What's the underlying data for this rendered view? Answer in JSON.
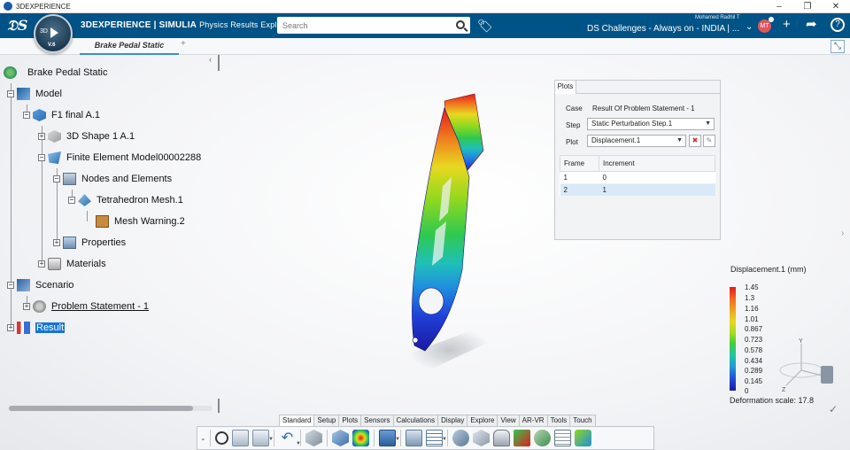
{
  "window": {
    "title": "3DEXPERIENCE",
    "buttons": [
      "–",
      "❐",
      "✕"
    ]
  },
  "topbar": {
    "brand_bold": "3DEXPERIENCE | SIMULIA",
    "app_name": "Physics Results Explorer",
    "compass": {
      "label_3d": "3D",
      "version": "V.6"
    },
    "search": {
      "value": "",
      "placeholder": "Search"
    },
    "user_name": "Mohamed Radhil T",
    "avatar_initials": "MT",
    "space_title": "DS Challenges - Always on - INDIA | ..."
  },
  "tabs": {
    "active": "Brake Pedal Static",
    "add": "+"
  },
  "tree": {
    "root": "Brake Pedal Static",
    "model": "Model",
    "part": "F1 final A.1",
    "shape": "3D Shape 1 A.1",
    "fem": "Finite Element Model00002288",
    "nodes": "Nodes and Elements",
    "tetra": "Tetrahedron Mesh.1",
    "warning": "Mesh Warning.2",
    "properties": "Properties",
    "materials": "Materials",
    "scenario": "Scenario",
    "problem": "Problem Statement - 1",
    "result": "Result"
  },
  "plots": {
    "tab": "Plots",
    "case_label": "Case",
    "case_value": "Result Of Problem Statement - 1",
    "step_label": "Step",
    "step_value": "Static Perturbation Step.1",
    "plot_label": "Plot",
    "plot_value": "Displacement.1",
    "columns": [
      "Frame",
      "Increment"
    ],
    "rows": [
      [
        "1",
        "0"
      ],
      [
        "2",
        "1"
      ]
    ],
    "selected_row": 1
  },
  "legend": {
    "title": "Displacement.1 (mm)",
    "values": [
      "1.45",
      "1.3",
      "1.16",
      "1.01",
      "0.867",
      "0.723",
      "0.578",
      "0.434",
      "0.289",
      "0.145",
      "0"
    ],
    "deformation": "Deformation scale: 17.8"
  },
  "triad": {
    "y": "Y",
    "z": "Z"
  },
  "bottom_tabs": [
    "Standard",
    "Setup",
    "Plots",
    "Sensors",
    "Calculations",
    "Display",
    "Explore",
    "View",
    "AR-VR",
    "Tools",
    "Touch"
  ],
  "colors": {
    "brand": "#005386",
    "accent": "#1874d1",
    "avatar": "#e2565c"
  }
}
